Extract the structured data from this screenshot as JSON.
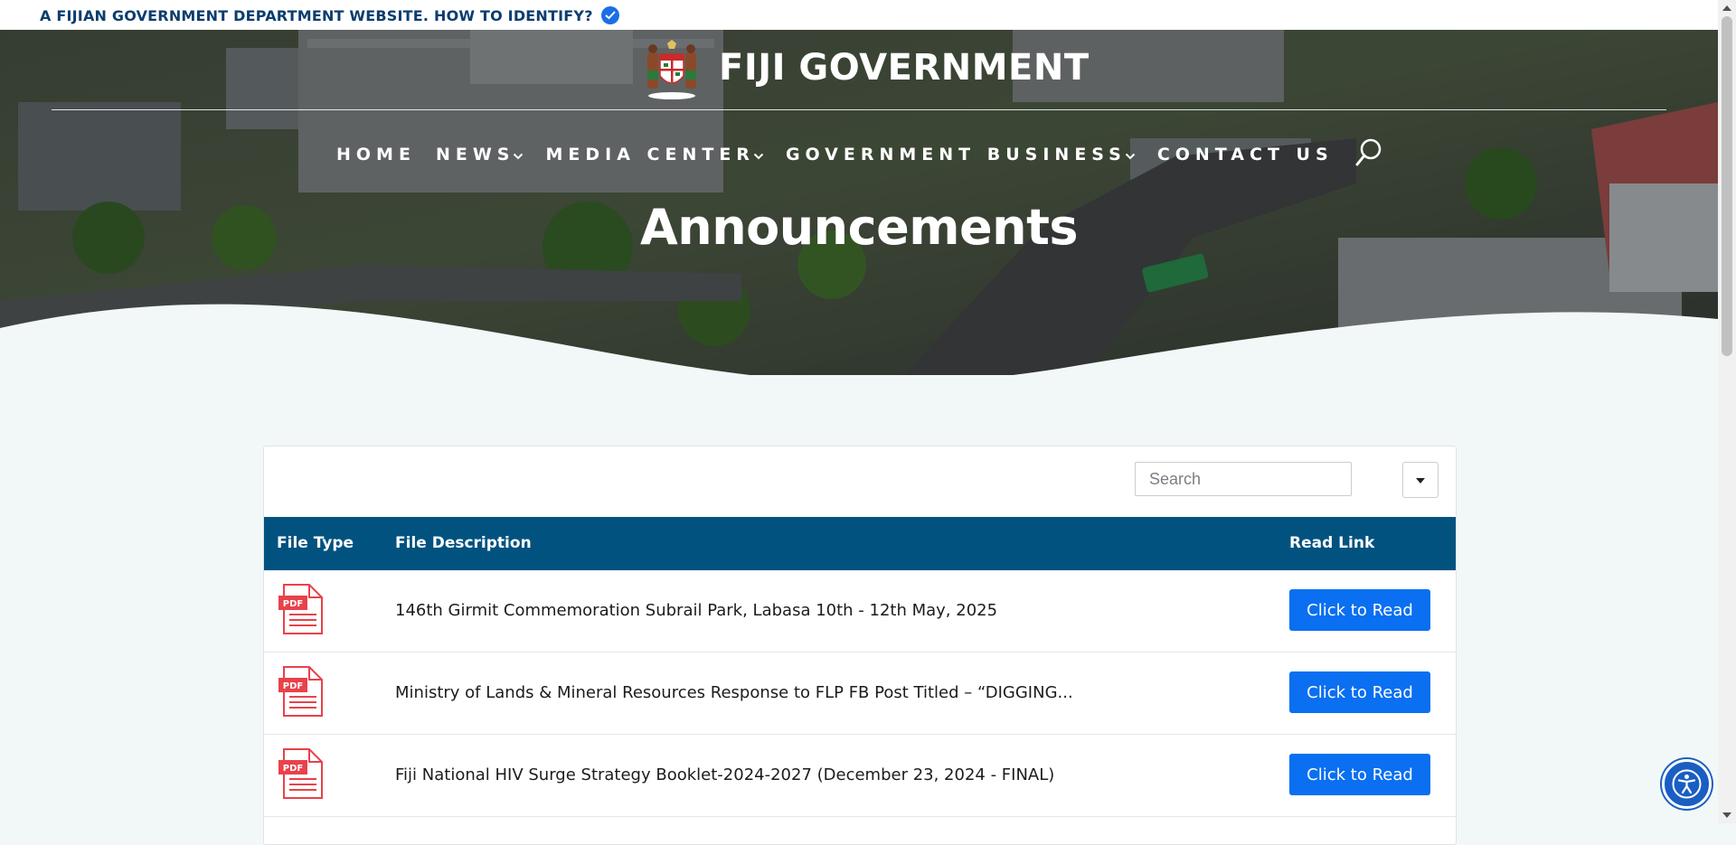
{
  "top_bar": {
    "text": "A FIJIAN GOVERNMENT DEPARTMENT WEBSITE. HOW TO IDENTIFY?",
    "icon": "verified-check-icon"
  },
  "header": {
    "site_title": "FIJI GOVERNMENT",
    "logo": "fiji-coat-of-arms",
    "nav": [
      {
        "label": "HOME",
        "has_dropdown": false
      },
      {
        "label": "NEWS",
        "has_dropdown": true
      },
      {
        "label": "MEDIA CENTER",
        "has_dropdown": true
      },
      {
        "label": "GOVERNMENT BUSINESS",
        "has_dropdown": true
      },
      {
        "label": "CONTACT US",
        "has_dropdown": false
      }
    ],
    "search_icon": "search-icon"
  },
  "page_title": "Announcements",
  "table": {
    "search_placeholder": "Search",
    "columns": [
      "File Type",
      "File Description",
      "Read Link"
    ],
    "rows": [
      {
        "file_type": "PDF",
        "description": "146th Girmit Commemoration Subrail Park, Labasa 10th - 12th May, 2025",
        "link_label": "Click to Read"
      },
      {
        "file_type": "PDF",
        "description": "Ministry of Lands & Mineral Resources Response to FLP FB Post Titled – “DIGGING...",
        "link_label": "Click to Read"
      },
      {
        "file_type": "PDF",
        "description": "Fiji National HIV Surge Strategy Booklet-2024-2027 (December 23, 2024 - FINAL)",
        "link_label": "Click to Read"
      }
    ]
  },
  "colors": {
    "top_bar_text": "#0c3d6f",
    "table_header_bg": "#02527f",
    "button_bg": "#0a6ff0",
    "page_bg": "#f2f8f8",
    "pdf_icon": "#e8424b"
  },
  "accessibility_icon": "accessibility-icon"
}
